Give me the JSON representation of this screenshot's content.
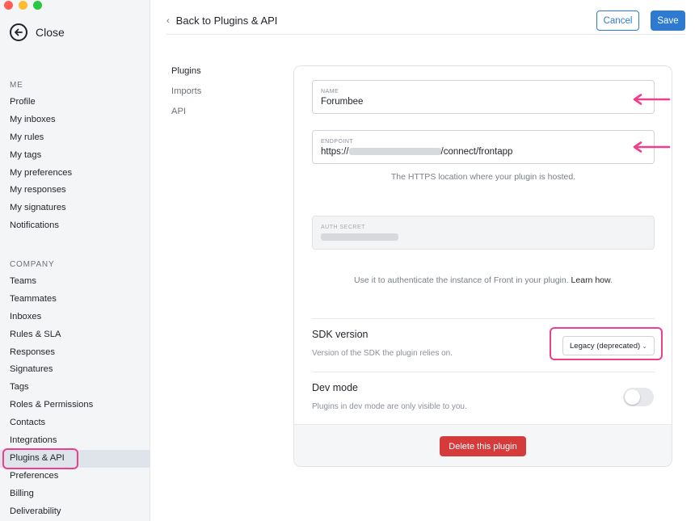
{
  "window": {
    "traffic_lights": {
      "close": "#ff5f57",
      "minimize": "#febc2e",
      "zoom": "#28c840"
    }
  },
  "sidebar": {
    "close_label": "Close",
    "me_section": {
      "label": "ME",
      "items": [
        "Profile",
        "My inboxes",
        "My rules",
        "My tags",
        "My preferences",
        "My responses",
        "My signatures",
        "Notifications"
      ]
    },
    "company_section": {
      "label": "COMPANY",
      "items": [
        "Teams",
        "Teammates",
        "Inboxes",
        "Rules & SLA",
        "Responses",
        "Signatures",
        "Tags",
        "Roles & Permissions",
        "Contacts",
        "Integrations",
        "Plugins & API",
        "Preferences",
        "Billing",
        "Deliverability"
      ]
    },
    "active_item": "Plugins & API"
  },
  "header": {
    "back_label": "Back to Plugins & API",
    "cancel_label": "Cancel",
    "save_label": "Save"
  },
  "subnav": {
    "items": [
      "Plugins",
      "Imports",
      "API"
    ],
    "active_item": "Plugins"
  },
  "form": {
    "name": {
      "label": "NAME",
      "value": "Forumbee"
    },
    "endpoint": {
      "label": "ENDPOINT",
      "value_prefix": "https://",
      "value_suffix": "/connect/frontapp",
      "helper": "The HTTPS location where your plugin is hosted."
    },
    "auth_secret": {
      "label": "AUTH SECRET",
      "helper_text": "Use it to authenticate the instance of Front in your plugin.",
      "helper_link": "Learn how"
    },
    "sdk_version": {
      "title": "SDK version",
      "description": "Version of the SDK the plugin relies on.",
      "selected": "Legacy (deprecated)"
    },
    "dev_mode": {
      "title": "Dev mode",
      "description": "Plugins in dev mode are only visible to you.",
      "enabled": false
    },
    "delete_label": "Delete this plugin"
  },
  "colors": {
    "accent": "#2e7ad1",
    "danger": "#d63b3b",
    "annotation": "#ec3f8c"
  }
}
